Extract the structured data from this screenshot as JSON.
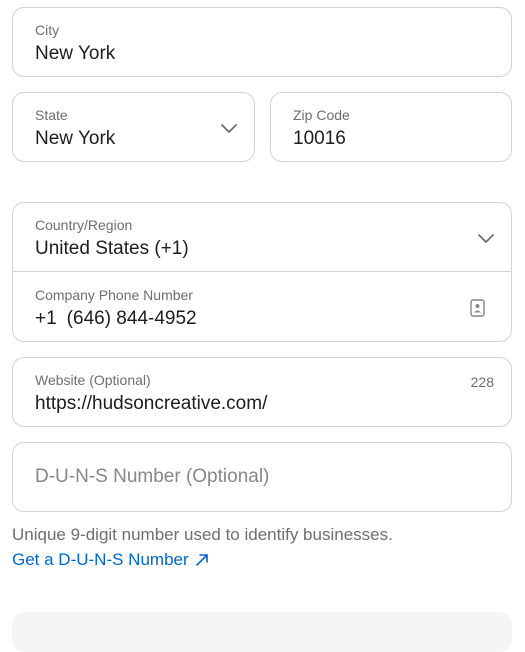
{
  "city": {
    "label": "City",
    "value": "New York"
  },
  "state": {
    "label": "State",
    "value": "New York"
  },
  "zip": {
    "label": "Zip Code",
    "value": "10016"
  },
  "country": {
    "label": "Country/Region",
    "value": "United States (+1)"
  },
  "phone": {
    "label": "Company Phone Number",
    "country_code": "+1",
    "value": "(646) 844-4952",
    "icon": "contact-card-icon"
  },
  "website": {
    "label": "Website (Optional)",
    "value": "https://hudsoncreative.com/",
    "char_count": "228"
  },
  "duns": {
    "placeholder": "D-U-N-S Number (Optional)",
    "helper": "Unique 9-digit number used to identify businesses.",
    "link": "Get a D-U-N-S Number"
  },
  "colors": {
    "accent": "#0066cc",
    "border": "#d2d2d7",
    "muted": "#6e6e73"
  }
}
